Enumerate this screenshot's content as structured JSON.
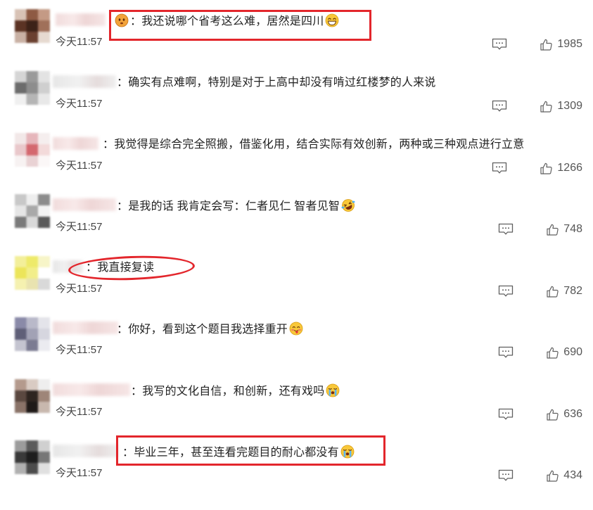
{
  "comments": [
    {
      "text": "：我还说哪个省考这么难，居然是四川",
      "emoji_before": "face-emoji",
      "emoji_after": "grinning-squint-emoji",
      "time": "今天11:57",
      "likes": 1985
    },
    {
      "text": "：确实有点难啊，特别是对于上高中却没有啃过红楼梦的人来说",
      "time": "今天11:57",
      "likes": 1309
    },
    {
      "text": "：我觉得是综合完全照搬，借鉴化用，结合实际有效创新，两种或三种观点进行立意",
      "time": "今天11:57",
      "likes": 1266
    },
    {
      "text": "：是我的话 我肯定会写：仁者见仁 智者见智",
      "emoji_after": "rolling-laughing-emoji",
      "time": "今天11:57",
      "likes": 748
    },
    {
      "text": "：我直接复读",
      "time": "今天11:57",
      "likes": 782
    },
    {
      "text": "：你好，看到这个题目我选择重开",
      "emoji_after": "yum-tongue-emoji",
      "time": "今天11:57",
      "likes": 690
    },
    {
      "text": "：我写的文化自信，和创新，还有戏吗",
      "emoji_after": "loudly-crying-emoji",
      "time": "今天11:57",
      "likes": 636
    },
    {
      "text": "：毕业三年，甚至连看完题目的耐心都没有",
      "emoji_after": "loudly-crying-emoji",
      "time": "今天11:57",
      "likes": 434
    }
  ],
  "icons": {
    "reply": "comment-bubble-icon",
    "like": "thumbs-up-icon"
  },
  "annotation_color": "#e3262c"
}
